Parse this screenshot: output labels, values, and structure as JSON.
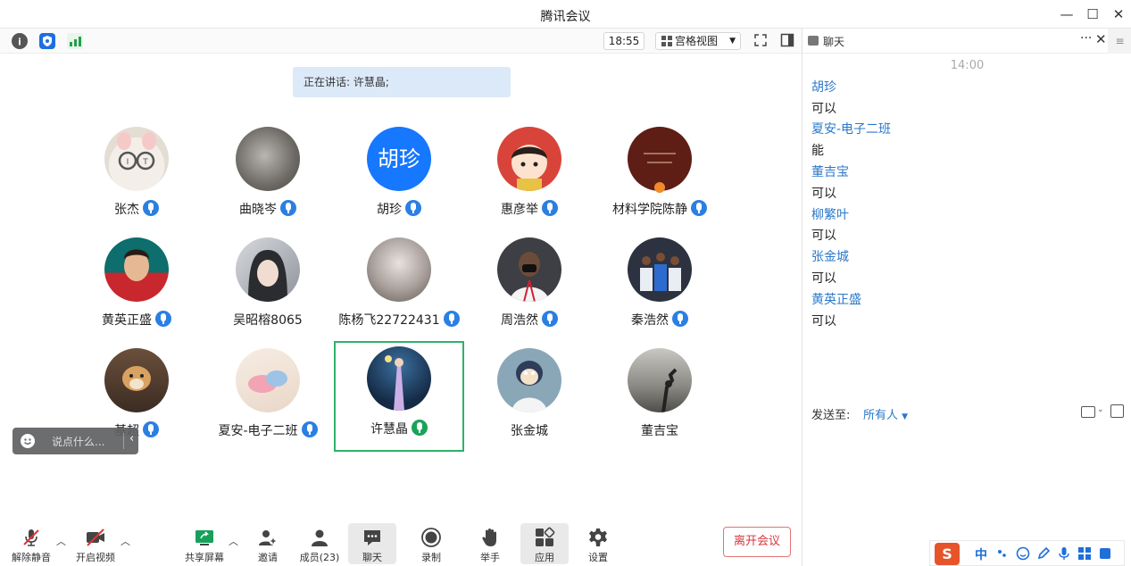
{
  "window": {
    "title": "腾讯会议",
    "controls": {
      "minimize": "—",
      "maximize": "☐",
      "close": "✕"
    }
  },
  "toolbar": {
    "time": "18:55",
    "view_mode": "宫格视图"
  },
  "speaking": {
    "label": "正在讲话: 许慧晶;"
  },
  "participants": [
    {
      "name": "张杰",
      "mic": "on"
    },
    {
      "name": "曲晓岑",
      "mic": "on"
    },
    {
      "name": "胡珍",
      "avatar_text": "胡珍",
      "mic": "on"
    },
    {
      "name": "惠彦举",
      "mic": "on"
    },
    {
      "name": "材料学院陈静",
      "mic": "on",
      "host": true
    },
    {
      "name": "黄英正盛",
      "mic": "on"
    },
    {
      "name": "吴昭榕8065",
      "mic": "none"
    },
    {
      "name": "陈杨飞22722431",
      "mic": "on"
    },
    {
      "name": "周浩然",
      "mic": "on"
    },
    {
      "name": "秦浩然",
      "mic": "on"
    },
    {
      "name": "基超",
      "mic": "on"
    },
    {
      "name": "夏安-电子二班",
      "mic": "on"
    },
    {
      "name": "许慧晶",
      "mic": "speaking",
      "active": true
    },
    {
      "name": "张金城",
      "mic": "none"
    },
    {
      "name": "董吉宝",
      "mic": "none"
    }
  ],
  "say_box": {
    "placeholder": "说点什么..."
  },
  "controls": {
    "unmute": "解除静音",
    "start_video": "开启视频",
    "share_screen": "共享屏幕",
    "invite": "邀请",
    "members": "成员(23)",
    "chat": "聊天",
    "record": "录制",
    "raise_hand": "举手",
    "apps": "应用",
    "settings": "设置",
    "leave": "离开会议"
  },
  "chat": {
    "title": "聊天",
    "timestamp": "14:00",
    "messages": [
      {
        "sender": "胡珍",
        "text": "可以"
      },
      {
        "sender": "夏安-电子二班",
        "text": "能"
      },
      {
        "sender": "董吉宝",
        "text": "可以"
      },
      {
        "sender": "柳繁叶",
        "text": "可以"
      },
      {
        "sender": "张金城",
        "text": "可以"
      },
      {
        "sender": "黄英正盛",
        "text": "可以"
      }
    ],
    "send_to_label": "发送至:",
    "send_to_value": "所有人"
  },
  "ime": {
    "lang": "中"
  },
  "colors": {
    "accent": "#1677ff",
    "mic_blue": "#2b7fe3",
    "speaking_green": "#19a35a",
    "leave_red": "#d9363e"
  }
}
